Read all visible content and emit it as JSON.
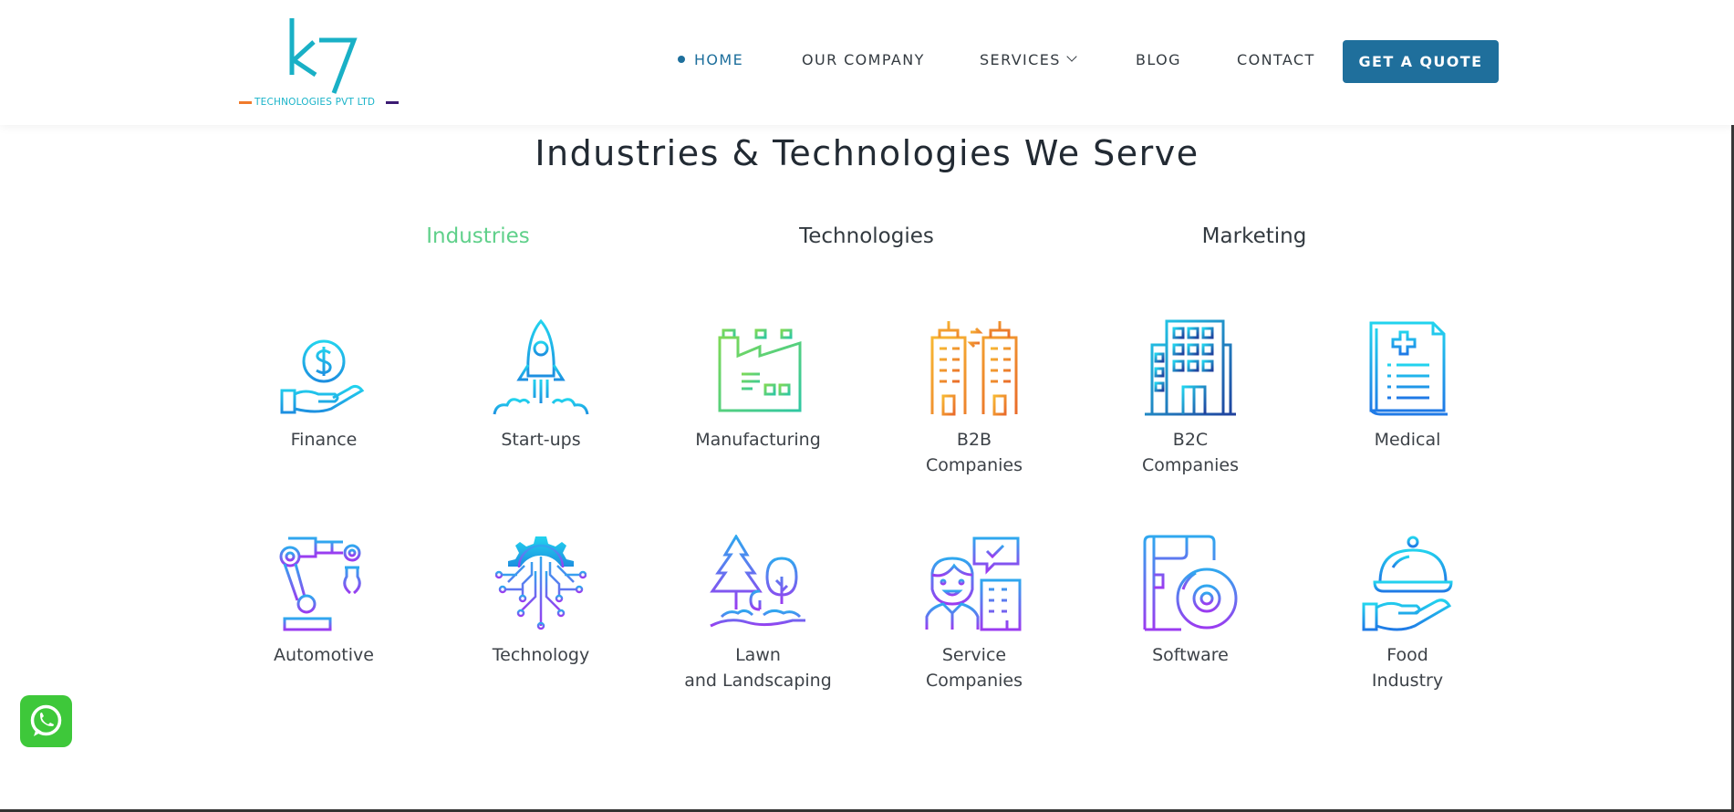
{
  "logo": {
    "mark": "k7",
    "tagline": "TECHNOLOGIES PVT LTD"
  },
  "nav": {
    "items": [
      "HOME",
      "OUR COMPANY",
      "SERVICES",
      "BLOG",
      "CONTACT"
    ],
    "cta": "GET A QUOTE"
  },
  "section": {
    "title": "Industries & Technologies We Serve",
    "tabs": [
      "Industries",
      "Technologies",
      "Marketing"
    ]
  },
  "industries": [
    {
      "label": "Finance",
      "icon": "finance-icon"
    },
    {
      "label": "Start-ups",
      "icon": "rocket-icon"
    },
    {
      "label": "Manufacturing",
      "icon": "factory-icon"
    },
    {
      "label": "B2B\nCompanies",
      "icon": "b2b-buildings-icon"
    },
    {
      "label": "B2C\nCompanies",
      "icon": "b2c-building-icon"
    },
    {
      "label": "Medical",
      "icon": "medical-report-icon"
    },
    {
      "label": "Automotive",
      "icon": "robot-arm-icon"
    },
    {
      "label": "Technology",
      "icon": "gear-circuit-icon"
    },
    {
      "label": "Lawn\nand Landscaping",
      "icon": "trees-icon"
    },
    {
      "label": "Service\nCompanies",
      "icon": "service-person-icon"
    },
    {
      "label": "Software",
      "icon": "software-disc-icon"
    },
    {
      "label": "Food\nIndustry",
      "icon": "food-cloche-icon"
    }
  ],
  "colors": {
    "accent": "#1f6f9c",
    "active_tab": "#5fd08a",
    "whatsapp": "#3ec83a"
  }
}
